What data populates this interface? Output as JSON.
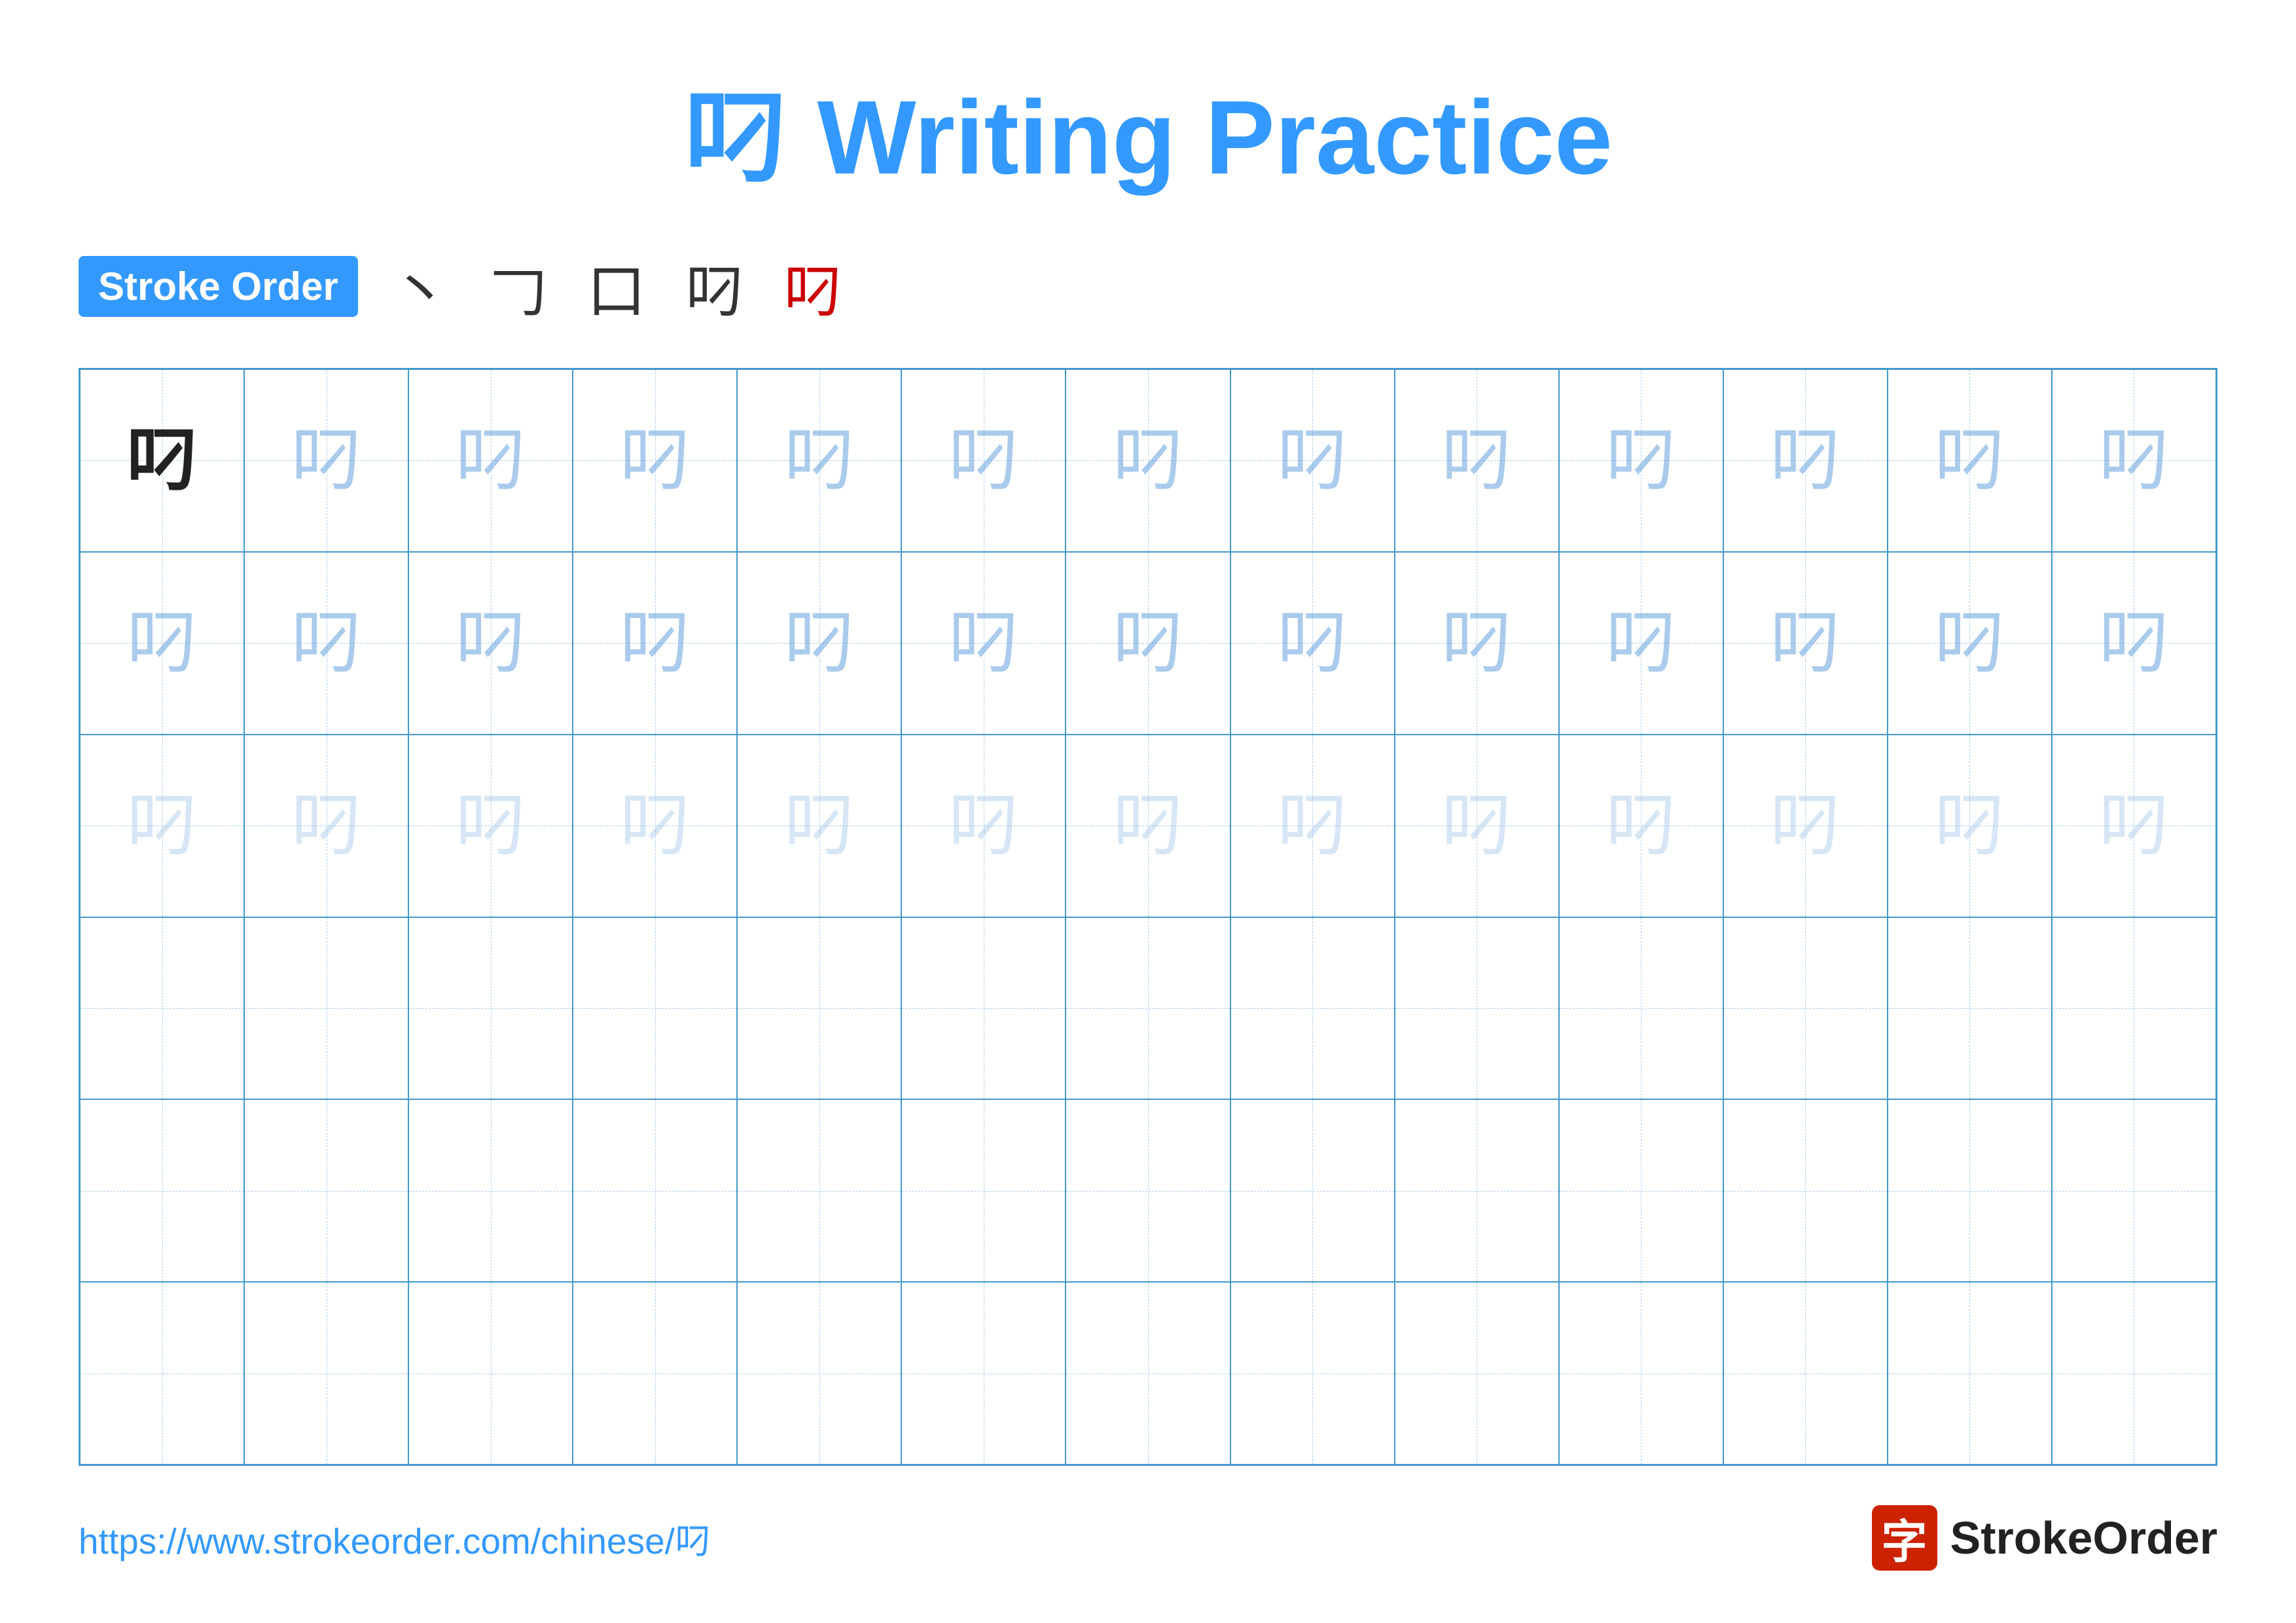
{
  "title": {
    "char": "叼",
    "practice_label": "Writing Practice"
  },
  "stroke_order": {
    "badge_label": "Stroke Order",
    "steps": [
      "丶",
      "𠃌",
      "口",
      "叼",
      "叼"
    ]
  },
  "grid": {
    "rows": 6,
    "cols": 13,
    "char": "叼",
    "row_types": [
      "solid_then_faint1",
      "faint1_then_faint2",
      "faint2_then_faint2",
      "empty",
      "empty",
      "empty"
    ]
  },
  "footer": {
    "url": "https://www.strokeorder.com/chinese/叼",
    "logo_char": "字",
    "logo_name": "StrokeOrder"
  }
}
